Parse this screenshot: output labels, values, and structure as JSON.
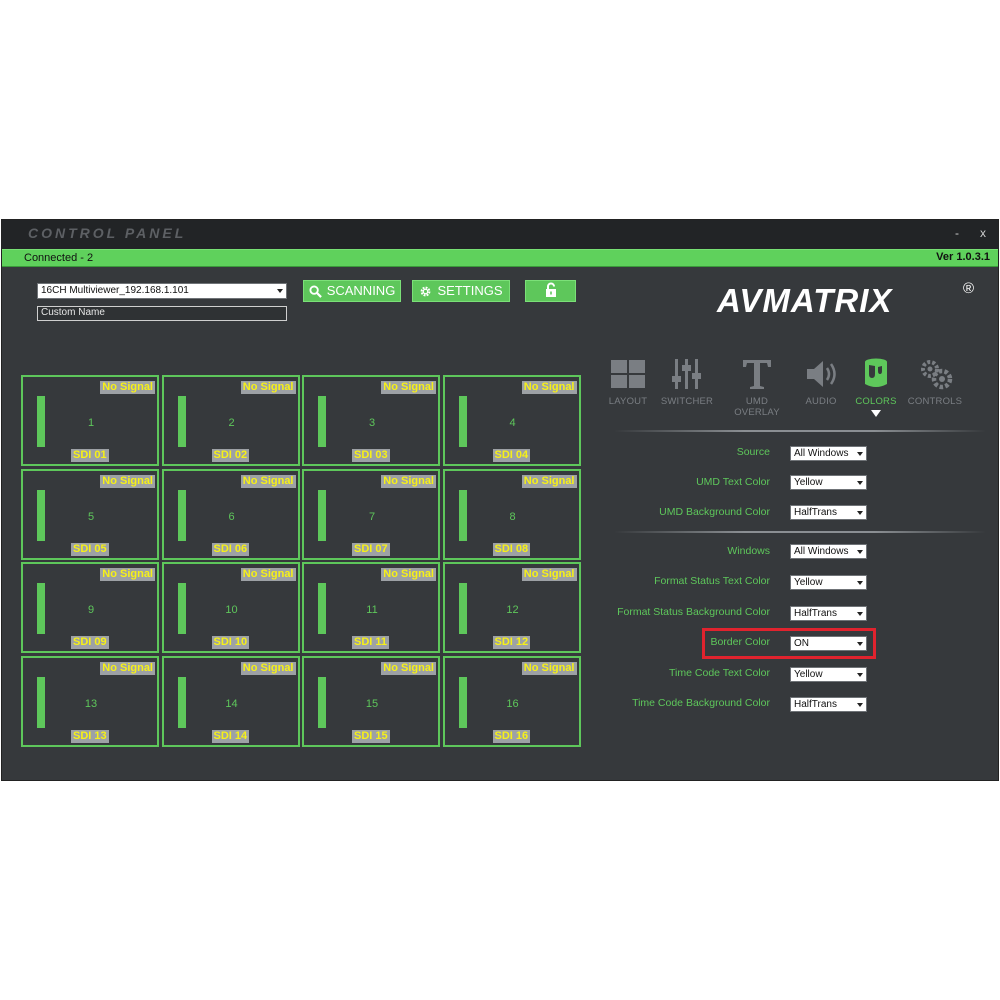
{
  "window": {
    "title": "CONTROL PANEL",
    "minimize_label": "-",
    "close_label": "x"
  },
  "status": {
    "connected": "Connected - 2",
    "version": "Ver 1.0.3.1"
  },
  "device": {
    "selected": "16CH Multiviewer_192.168.1.101",
    "custom_name": "Custom Name"
  },
  "toolbar": {
    "scan_label": "SCANNING",
    "settings_label": "SETTINGS"
  },
  "brand": {
    "logo": "AVMATRIX",
    "reg": "®"
  },
  "colors": {
    "accent": "#5ec75b",
    "background": "#36393c",
    "signal_text": "#f6f018",
    "highlight": "#e0232e"
  },
  "tabs": [
    {
      "label": "LAYOUT",
      "icon": "layout-icon"
    },
    {
      "label": "SWITCHER",
      "icon": "switcher-icon"
    },
    {
      "label": "UMD OVERLAY",
      "icon": "umd-overlay-icon"
    },
    {
      "label": "AUDIO",
      "icon": "audio-icon"
    },
    {
      "label": "COLORS",
      "icon": "colors-icon",
      "active": true
    },
    {
      "label": "CONTROLS",
      "icon": "controls-icon"
    }
  ],
  "windows": [
    {
      "number": "1",
      "name": "SDI 01",
      "status": "No Signal"
    },
    {
      "number": "2",
      "name": "SDI 02",
      "status": "No Signal"
    },
    {
      "number": "3",
      "name": "SDI 03",
      "status": "No Signal"
    },
    {
      "number": "4",
      "name": "SDI 04",
      "status": "No Signal"
    },
    {
      "number": "5",
      "name": "SDI 05",
      "status": "No Signal"
    },
    {
      "number": "6",
      "name": "SDI 06",
      "status": "No Signal"
    },
    {
      "number": "7",
      "name": "SDI 07",
      "status": "No Signal"
    },
    {
      "number": "8",
      "name": "SDI 08",
      "status": "No Signal"
    },
    {
      "number": "9",
      "name": "SDI 09",
      "status": "No Signal"
    },
    {
      "number": "10",
      "name": "SDI 10",
      "status": "No Signal"
    },
    {
      "number": "11",
      "name": "SDI 11",
      "status": "No Signal"
    },
    {
      "number": "12",
      "name": "SDI 12",
      "status": "No Signal"
    },
    {
      "number": "13",
      "name": "SDI 13",
      "status": "No Signal"
    },
    {
      "number": "14",
      "name": "SDI 14",
      "status": "No Signal"
    },
    {
      "number": "15",
      "name": "SDI 15",
      "status": "No Signal"
    },
    {
      "number": "16",
      "name": "SDI 16",
      "status": "No Signal"
    }
  ],
  "settings": {
    "umd": [
      {
        "label": "Source",
        "value": "All Windows"
      },
      {
        "label": "UMD Text Color",
        "value": "Yellow"
      },
      {
        "label": "UMD Background Color",
        "value": "HalfTrans"
      }
    ],
    "window": [
      {
        "label": "Windows",
        "value": "All Windows"
      },
      {
        "label": "Format Status Text Color",
        "value": "Yellow"
      },
      {
        "label": "Format Status Background Color",
        "value": "HalfTrans"
      },
      {
        "label": "Border Color",
        "value": "ON"
      },
      {
        "label": "Time Code Text Color",
        "value": "Yellow"
      },
      {
        "label": "Time Code  Background Color",
        "value": "HalfTrans"
      }
    ]
  }
}
